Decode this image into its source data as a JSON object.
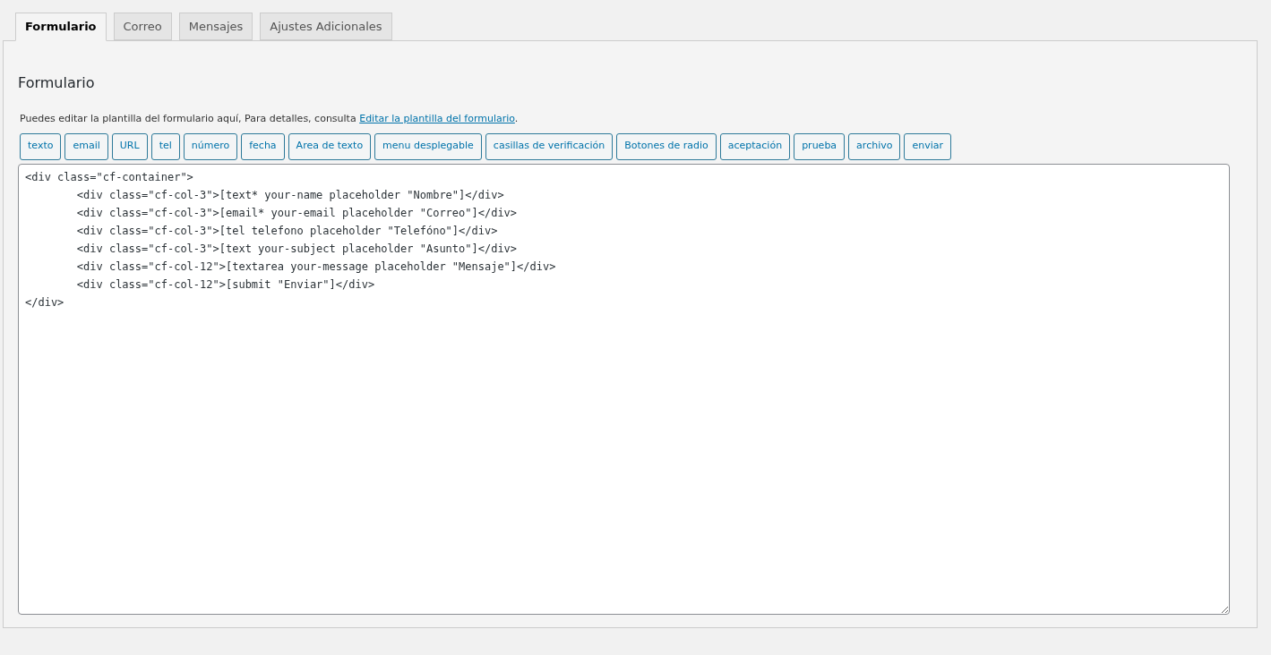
{
  "tabs": [
    {
      "label": "Formulario",
      "selected": true
    },
    {
      "label": "Correo",
      "selected": false
    },
    {
      "label": "Mensajes",
      "selected": false
    },
    {
      "label": "Ajustes Adicionales",
      "selected": false
    }
  ],
  "panel": {
    "title": "Formulario",
    "description": "Puedes editar la plantilla del formulario aquí, Para detalles, consulta ",
    "link": "Editar la plantilla del formulario",
    "description_end": ".",
    "tag_buttons": [
      "texto",
      "email",
      "URL",
      "tel",
      "número",
      "fecha",
      "Area de texto",
      "menu desplegable",
      "casillas de verificación",
      "Botones de radio",
      "aceptación",
      "prueba",
      "archivo",
      "enviar"
    ],
    "editor": {
      "value": "<div class=\"cf-container\">\n\t<div class=\"cf-col-3\">[text* your-name placeholder \"Nombre\"]</div>\n\t<div class=\"cf-col-3\">[email* your-email placeholder \"Correo\"]</div>\n\t<div class=\"cf-col-3\">[tel telefono placeholder \"Telefóno\"]</div>\n\t<div class=\"cf-col-3\">[text your-subject placeholder \"Asunto\"]</div>\n\t<div class=\"cf-col-12\">[textarea your-message placeholder \"Mensaje\"]</div>\n\t<div class=\"cf-col-12\">[submit \"Enviar\"]</div>\n</div>"
    }
  }
}
